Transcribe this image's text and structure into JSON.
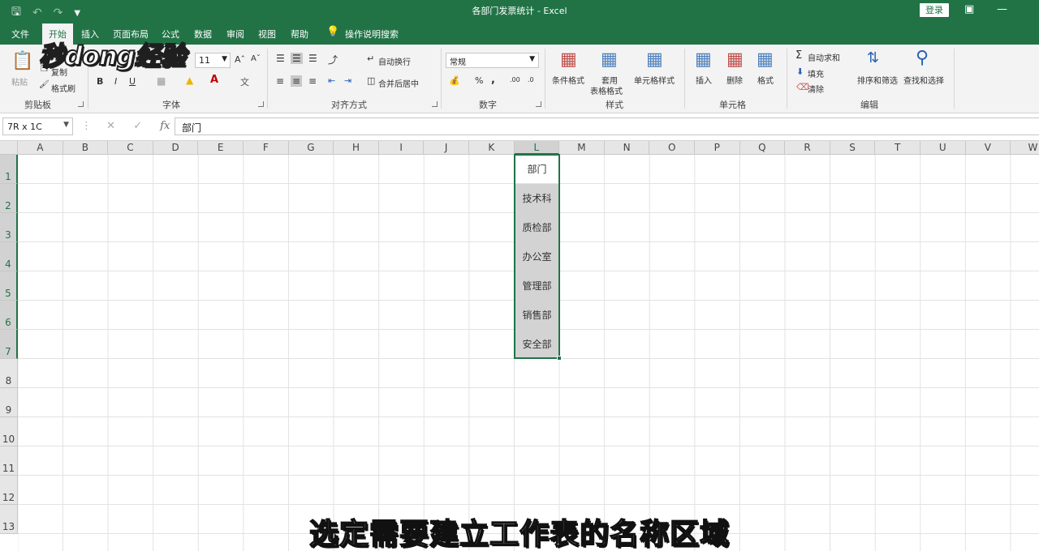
{
  "titlebar": {
    "title": "各部门发票统计  -  Excel",
    "login": "登录"
  },
  "menu": {
    "tabs": [
      "文件",
      "开始",
      "插入",
      "页面布局",
      "公式",
      "数据",
      "审阅",
      "视图",
      "帮助"
    ],
    "active_tab": "开始",
    "tell_me": "操作说明搜索"
  },
  "ribbon": {
    "clipboard": {
      "paste": "粘贴",
      "copy": "复制",
      "format_painter": "格式刷",
      "label": "剪贴板"
    },
    "font": {
      "size": "11",
      "label": "字体"
    },
    "alignment": {
      "wrap": "自动换行",
      "merge": "合并后居中",
      "label": "对齐方式"
    },
    "number": {
      "format": "常规",
      "label": "数字"
    },
    "styles": {
      "conditional": "条件格式",
      "table_fmt_1": "套用",
      "table_fmt_2": "表格格式",
      "cell_styles": "单元格样式",
      "label": "样式"
    },
    "cells": {
      "insert": "插入",
      "delete": "删除",
      "format": "格式",
      "label": "单元格"
    },
    "editing": {
      "autosum": "自动求和",
      "fill": "填充",
      "clear": "清除",
      "sort": "排序和筛选",
      "find": "查找和选择",
      "label": "编辑"
    }
  },
  "logo_text": "秒dong经验",
  "formula_bar": {
    "name_box": "7R x 1C",
    "fx": "fx",
    "content": "部门"
  },
  "grid": {
    "columns": [
      "A",
      "B",
      "C",
      "D",
      "E",
      "F",
      "G",
      "H",
      "I",
      "J",
      "K",
      "L",
      "M",
      "N",
      "O",
      "P",
      "Q",
      "R",
      "S",
      "T",
      "U",
      "V",
      "W"
    ],
    "rows": [
      "1",
      "2",
      "3",
      "4",
      "5",
      "6",
      "7",
      "8",
      "9",
      "10",
      "11",
      "12",
      "13"
    ],
    "selected_column": "L",
    "cells_L": [
      "部门",
      "技术科",
      "质检部",
      "办公室",
      "管理部",
      "销售部",
      "安全部"
    ]
  },
  "subtitle": "选定需要建立工作表的名称区域",
  "colors": {
    "excel_green": "#217346",
    "selection_fill": "#d3d3d3"
  }
}
